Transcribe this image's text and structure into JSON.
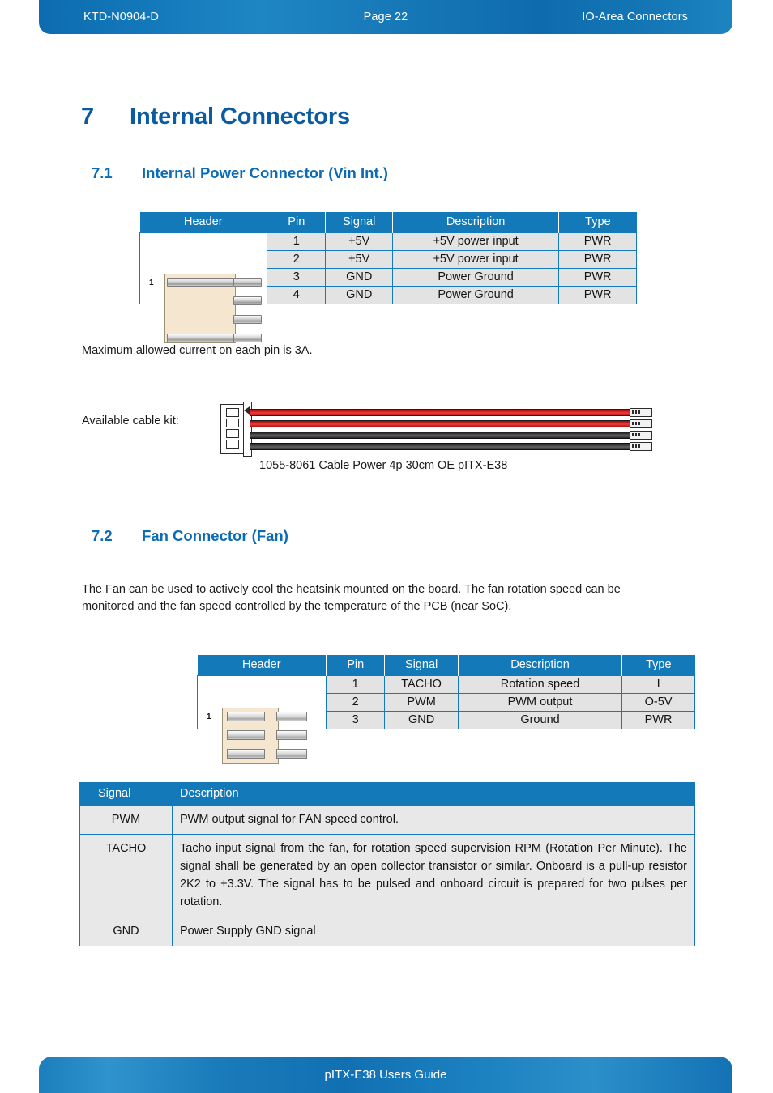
{
  "header": {
    "doc_id": "KTD-N0904-D",
    "page": "Page 22",
    "section": "IO-Area Connectors"
  },
  "footer": {
    "title": "pITX-E38 Users Guide"
  },
  "chapter": {
    "number": "7",
    "title": "Internal Connectors"
  },
  "section_71": {
    "number": "7.1",
    "title": "Internal Power Connector (Vin Int.)",
    "note": "Maximum allowed current on each pin is 3A.",
    "cable_label": "Available cable kit:",
    "cable_caption": "1055-8061 Cable Power 4p 30cm OE pITX-E38",
    "table": {
      "columns": [
        "Header",
        "Pin",
        "Signal",
        "Description",
        "Type"
      ],
      "pin_marker": "1",
      "rows": [
        {
          "pin": "1",
          "signal": "+5V",
          "description": "+5V power input",
          "type": "PWR"
        },
        {
          "pin": "2",
          "signal": "+5V",
          "description": "+5V power input",
          "type": "PWR"
        },
        {
          "pin": "3",
          "signal": "GND",
          "description": "Power Ground",
          "type": "PWR"
        },
        {
          "pin": "4",
          "signal": "GND",
          "description": "Power Ground",
          "type": "PWR"
        }
      ]
    }
  },
  "section_72": {
    "number": "7.2",
    "title": "Fan Connector (Fan)",
    "intro": "The Fan can be used to actively cool the heatsink mounted on the board. The fan rotation speed can be monitored and the fan speed controlled by the temperature of the PCB (near SoC).",
    "table": {
      "columns": [
        "Header",
        "Pin",
        "Signal",
        "Description",
        "Type"
      ],
      "pin_marker": "1",
      "rows": [
        {
          "pin": "1",
          "signal": "TACHO",
          "description": "Rotation speed",
          "type": "I"
        },
        {
          "pin": "2",
          "signal": "PWM",
          "description": "PWM output",
          "type": "O-5V"
        },
        {
          "pin": "3",
          "signal": "GND",
          "description": "Ground",
          "type": "PWR"
        }
      ]
    },
    "signal_table": {
      "columns": [
        "Signal",
        "Description"
      ],
      "rows": [
        {
          "signal": "PWM",
          "description": "PWM output signal for FAN speed control."
        },
        {
          "signal": "TACHO",
          "description": "Tacho input signal from the fan, for rotation speed supervision RPM (Rotation Per Minute). The signal shall be generated by an open collector transistor or similar. Onboard is a pull-up resistor 2K2 to +3.3V. The signal has to be pulsed and onboard circuit is prepared for two pulses per rotation."
        },
        {
          "signal": "GND",
          "description": "Power Supply GND signal"
        }
      ]
    }
  },
  "colors": {
    "brand_blue": "#1479b8",
    "heading_blue": "#0b6bb5",
    "chapter_blue": "#0b5ba0",
    "table_cell_gray": "#e3e3e3",
    "connector_beige": "#f5e7cf",
    "wire_red": "#d81f1f",
    "wire_black": "#3a3a3a"
  }
}
